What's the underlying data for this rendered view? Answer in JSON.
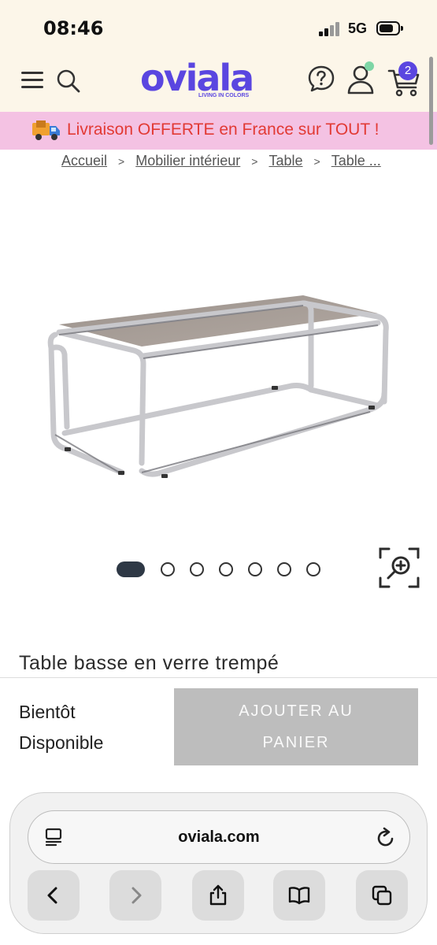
{
  "status_bar": {
    "time": "08:46",
    "network": "5G"
  },
  "header": {
    "logo_text": "oviala",
    "logo_tagline": "LIVING IN COLORS",
    "cart_count": "2",
    "brand_color": "#5a46e0"
  },
  "promo": {
    "text_part1": "Livraison ",
    "text_bold1": "OFFERTE",
    "text_part2": " en France sur ",
    "text_bold2": "TOUT",
    "text_part3": " !",
    "color": "#e23a34",
    "background": "#f4c2e3"
  },
  "breadcrumb": {
    "items": [
      "Accueil",
      "Mobilier intérieur",
      "Table",
      "Table ..."
    ],
    "separator": ">"
  },
  "carousel": {
    "total": 7,
    "active_index": 0
  },
  "product": {
    "title": "Table basse en verre trempé",
    "availability_line1": "Bientôt",
    "availability_line2": "Disponible",
    "add_to_cart_line1": "AJOUTER AU",
    "add_to_cart_line2": "PANIER"
  },
  "browser": {
    "url": "oviala.com"
  },
  "icons": [
    "menu-icon",
    "search-icon",
    "help-icon",
    "user-icon",
    "cart-icon",
    "truck-icon",
    "zoom-icon",
    "tab-icon",
    "reload-icon",
    "back-icon",
    "forward-icon",
    "share-icon",
    "bookmarks-icon",
    "tabs-icon"
  ]
}
